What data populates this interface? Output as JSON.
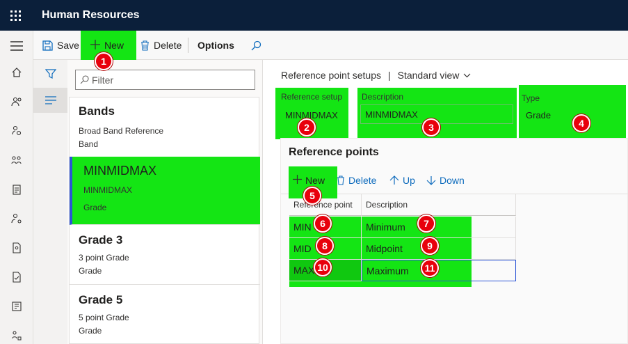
{
  "app": {
    "title": "Human Resources"
  },
  "toolbar": {
    "save": "Save",
    "new": "New",
    "delete": "Delete",
    "options": "Options"
  },
  "filter": {
    "placeholder": "Filter"
  },
  "list": [
    {
      "title": "Bands",
      "line1": "Broad Band Reference",
      "line2": "Band"
    },
    {
      "title": "MINMIDMAX",
      "line1": "MINMIDMAX",
      "line2": "Grade"
    },
    {
      "title": "Grade 3",
      "line1": "3 point Grade",
      "line2": "Grade"
    },
    {
      "title": "Grade 5",
      "line1": "5 point Grade",
      "line2": "Grade"
    }
  ],
  "breadcrumb": {
    "page": "Reference point setups",
    "separator": "|",
    "view": "Standard view"
  },
  "header": {
    "setup_label": "Reference setup",
    "setup_value": "MINMIDMAX",
    "desc_label": "Description",
    "desc_value": "MINMIDMAX",
    "type_label": "Type",
    "type_value": "Grade"
  },
  "refpoints": {
    "title": "Reference points",
    "toolbar": {
      "new": "New",
      "delete": "Delete",
      "up": "Up",
      "down": "Down"
    },
    "columns": [
      "Reference point",
      "Description"
    ],
    "rows": [
      {
        "point": "MIN",
        "desc": "Minimum"
      },
      {
        "point": "MID",
        "desc": "Midpoint"
      },
      {
        "point": "MAX",
        "desc": "Maximum"
      }
    ]
  },
  "badges": [
    "1",
    "2",
    "3",
    "4",
    "5",
    "6",
    "7",
    "8",
    "9",
    "10",
    "11"
  ],
  "colors": {
    "topbar": "#0b1f3a",
    "highlight": "#14e514",
    "badge": "#e8000c",
    "accent": "#0f6cbd",
    "selection": "#2b55d6"
  }
}
